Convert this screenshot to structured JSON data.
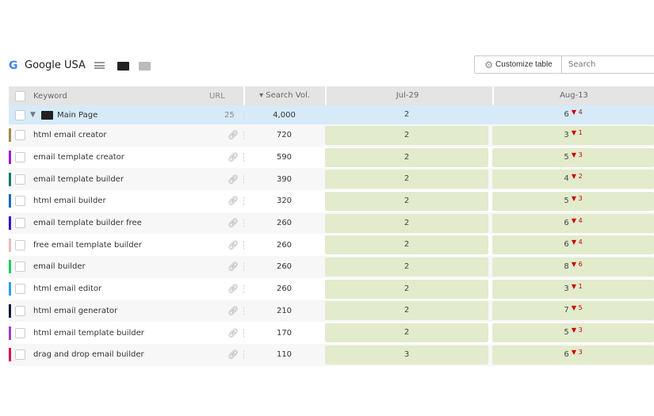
{
  "header": {
    "location": "Google USA",
    "customize_label": "Customize table",
    "search_placeholder": "Search"
  },
  "columns": {
    "keyword": "Keyword",
    "url": "URL",
    "search_vol": "▾ Search Vol.",
    "date1": "Jul-29",
    "date2": "Aug-13"
  },
  "group": {
    "name": "Main Page",
    "url_count": "25",
    "search_vol": "4,000",
    "date1": "2",
    "date2": "6",
    "change": "4"
  },
  "rows": [
    {
      "keyword": "html email creator",
      "vol": "720",
      "d1": "2",
      "d2": "3",
      "chg": "1",
      "color": "#a08a50"
    },
    {
      "keyword": "email template creator",
      "vol": "590",
      "d1": "2",
      "d2": "5",
      "chg": "3",
      "color": "#9b1fe0"
    },
    {
      "keyword": "email template builder",
      "vol": "390",
      "d1": "2",
      "d2": "4",
      "chg": "2",
      "color": "#127a6a"
    },
    {
      "keyword": "html email builder",
      "vol": "320",
      "d1": "2",
      "d2": "5",
      "chg": "3",
      "color": "#1769c4"
    },
    {
      "keyword": "email template builder free",
      "vol": "260",
      "d1": "2",
      "d2": "6",
      "chg": "4",
      "color": "#3a0fd0"
    },
    {
      "keyword": "free email template builder",
      "vol": "260",
      "d1": "2",
      "d2": "6",
      "chg": "4",
      "color": "#f0b8bc"
    },
    {
      "keyword": "email builder",
      "vol": "260",
      "d1": "2",
      "d2": "8",
      "chg": "6",
      "color": "#15d060"
    },
    {
      "keyword": "html email editor",
      "vol": "260",
      "d1": "2",
      "d2": "3",
      "chg": "1",
      "color": "#2aa0f0"
    },
    {
      "keyword": "html email generator",
      "vol": "210",
      "d1": "2",
      "d2": "7",
      "chg": "5",
      "color": "#101830"
    },
    {
      "keyword": "html email template builder",
      "vol": "170",
      "d1": "2",
      "d2": "5",
      "chg": "3",
      "color": "#a040c0"
    },
    {
      "keyword": "drag and drop email builder",
      "vol": "110",
      "d1": "3",
      "d2": "6",
      "chg": "3",
      "color": "#e0104a"
    }
  ]
}
